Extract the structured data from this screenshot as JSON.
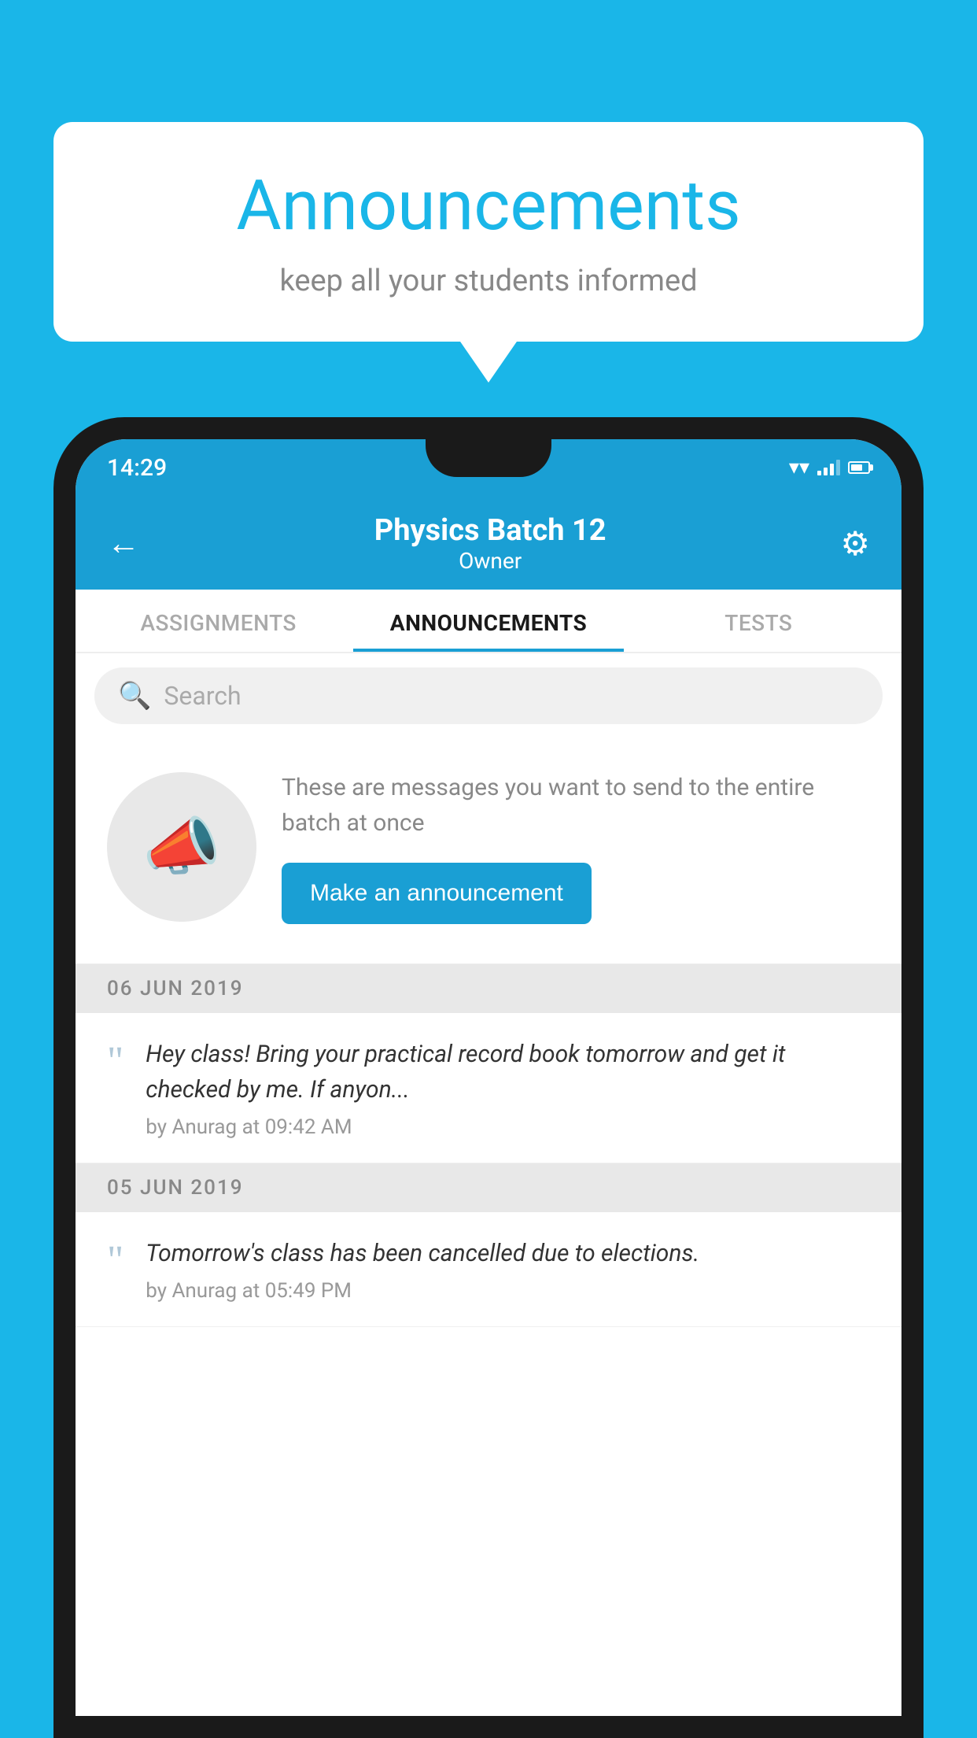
{
  "bubble": {
    "title": "Announcements",
    "subtitle": "keep all your students informed"
  },
  "phone": {
    "status_bar": {
      "time": "14:29"
    },
    "header": {
      "batch_name": "Physics Batch 12",
      "role": "Owner",
      "back_label": "←",
      "gear_label": "⚙"
    },
    "tabs": [
      {
        "label": "ASSIGNMENTS",
        "active": false
      },
      {
        "label": "ANNOUNCEMENTS",
        "active": true
      },
      {
        "label": "TESTS",
        "active": false
      }
    ],
    "search": {
      "placeholder": "Search"
    },
    "announcement_prompt": {
      "description": "These are messages you want to send to the entire batch at once",
      "button_label": "Make an announcement"
    },
    "announcements": [
      {
        "date": "06  JUN  2019",
        "message": "Hey class! Bring your practical record book tomorrow and get it checked by me. If anyon...",
        "meta": "by Anurag at 09:42 AM"
      },
      {
        "date": "05  JUN  2019",
        "message": "Tomorrow's class has been cancelled due to elections.",
        "meta": "by Anurag at 05:49 PM"
      }
    ]
  }
}
